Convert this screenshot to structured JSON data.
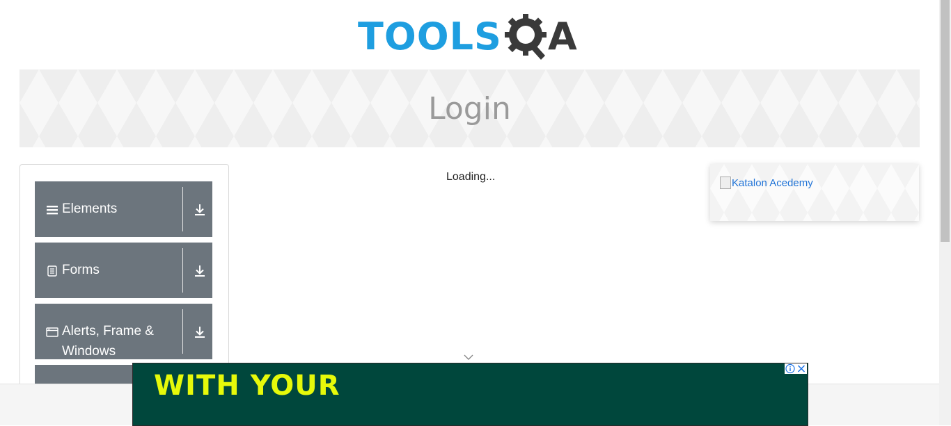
{
  "logo": {
    "tools_text": "TOOLS",
    "a_text": "A",
    "colors": {
      "tools": "#1e9ee0",
      "qa": "#3a3a3a"
    }
  },
  "banner": {
    "title": "Login"
  },
  "sidebar": {
    "groups": [
      {
        "label": "Elements",
        "icon": "hamburger-icon"
      },
      {
        "label": "Forms",
        "icon": "document-icon"
      },
      {
        "label": "Alerts, Frame &",
        "label2": "Windows",
        "icon": "window-icon"
      }
    ],
    "group_color": "#6c757d"
  },
  "main": {
    "loading_text": "Loading..."
  },
  "ad_card": {
    "image_alt": "Katalon Acedemy"
  },
  "bottom_ad": {
    "text": "WITH YOUR",
    "bg_color": "#00473c",
    "text_color": "#e6f90a"
  }
}
